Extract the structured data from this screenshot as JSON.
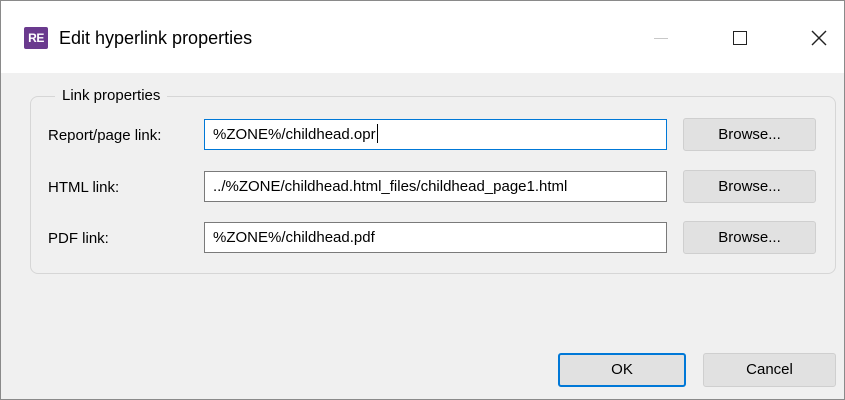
{
  "window": {
    "title": "Edit hyperlink properties",
    "app_icon_text": "RE"
  },
  "group": {
    "title": "Link properties"
  },
  "rows": [
    {
      "label": "Report/page link:",
      "value": "%ZONE%/childhead.opr",
      "browse_label": "Browse..."
    },
    {
      "label": "HTML link:",
      "value": "../%ZONE/childhead.html_files/childhead_page1.html",
      "browse_label": "Browse..."
    },
    {
      "label": "PDF link:",
      "value": "%ZONE%/childhead.pdf",
      "browse_label": "Browse..."
    }
  ],
  "buttons": {
    "ok": "OK",
    "cancel": "Cancel"
  },
  "colors": {
    "accent": "#0078d7",
    "app_icon": "#6a3a8e",
    "background": "#f0f0f0"
  }
}
